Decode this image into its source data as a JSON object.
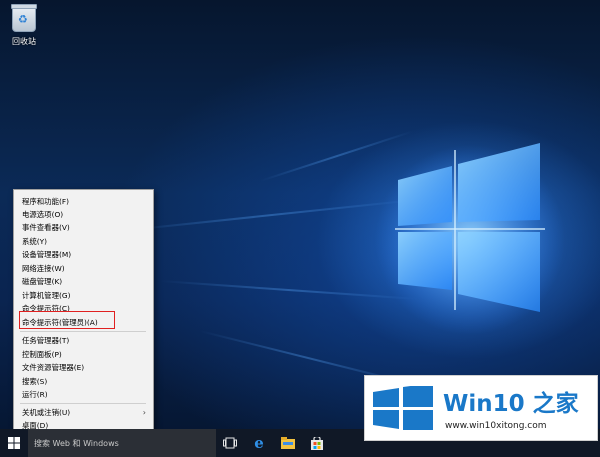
{
  "desktop": {
    "recycle_bin_label": "回收站"
  },
  "context_menu": {
    "items": [
      {
        "label": "程序和功能(F)"
      },
      {
        "label": "电源选项(O)"
      },
      {
        "label": "事件查看器(V)"
      },
      {
        "label": "系统(Y)"
      },
      {
        "label": "设备管理器(M)"
      },
      {
        "label": "网络连接(W)"
      },
      {
        "label": "磁盘管理(K)"
      },
      {
        "label": "计算机管理(G)"
      },
      {
        "label": "命令提示符(C)"
      },
      {
        "label": "命令提示符(管理员)(A)"
      },
      {
        "label": "任务管理器(T)"
      },
      {
        "label": "控制面板(P)"
      },
      {
        "label": "文件资源管理器(E)"
      },
      {
        "label": "搜索(S)"
      },
      {
        "label": "运行(R)"
      },
      {
        "label": "关机或注销(U)"
      },
      {
        "label": "桌面(D)"
      }
    ],
    "highlighted_item": "命令提示符(管理员)(A)",
    "submenu_arrow": "›"
  },
  "taskbar": {
    "search_placeholder": "搜索 Web 和 Windows",
    "icons": [
      "windows-start-icon",
      "task-view-icon",
      "edge-icon",
      "file-explorer-icon",
      "store-icon"
    ]
  },
  "watermark": {
    "title_latin": "Win10",
    "title_chinese": "之家",
    "url": "www.win10xitong.com"
  },
  "colors": {
    "accent": "#1a78c8",
    "highlight_border": "#e02020",
    "menu_bg": "#f2f2f2",
    "taskbar_bg": "#101826"
  }
}
